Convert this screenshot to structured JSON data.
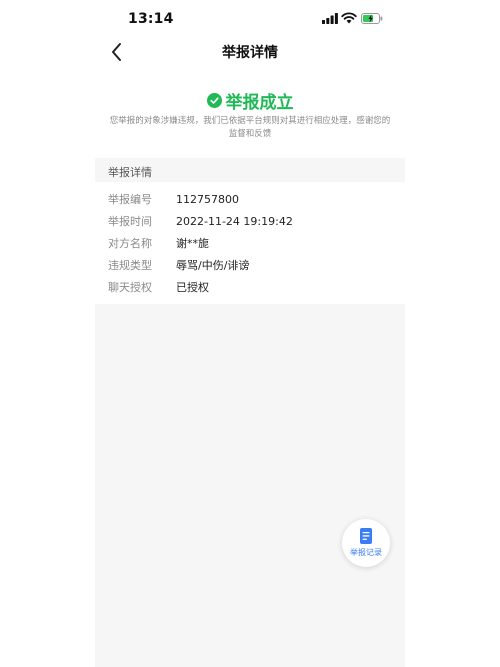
{
  "status_bar": {
    "time": "13:14"
  },
  "nav": {
    "title": "举报详情"
  },
  "result": {
    "title": "举报成立",
    "description": "您举报的对象涉嫌违规，我们已依据平台规则对其进行相应处理，感谢您的监督和反馈"
  },
  "details": {
    "section_title": "举报详情",
    "rows": [
      {
        "label": "举报编号",
        "value": "112757800"
      },
      {
        "label": "举报时间",
        "value": "2022-11-24 19:19:42"
      },
      {
        "label": "对方名称",
        "value": "谢**旎"
      },
      {
        "label": "违规类型",
        "value": "辱骂/中伤/诽谤"
      },
      {
        "label": "聊天授权",
        "value": "已授权"
      }
    ]
  },
  "fab": {
    "label": "举报记录",
    "icon": "document-icon"
  },
  "colors": {
    "success": "#1fb955",
    "accent": "#3a7cf6",
    "section_bg": "#f6f6f6"
  }
}
